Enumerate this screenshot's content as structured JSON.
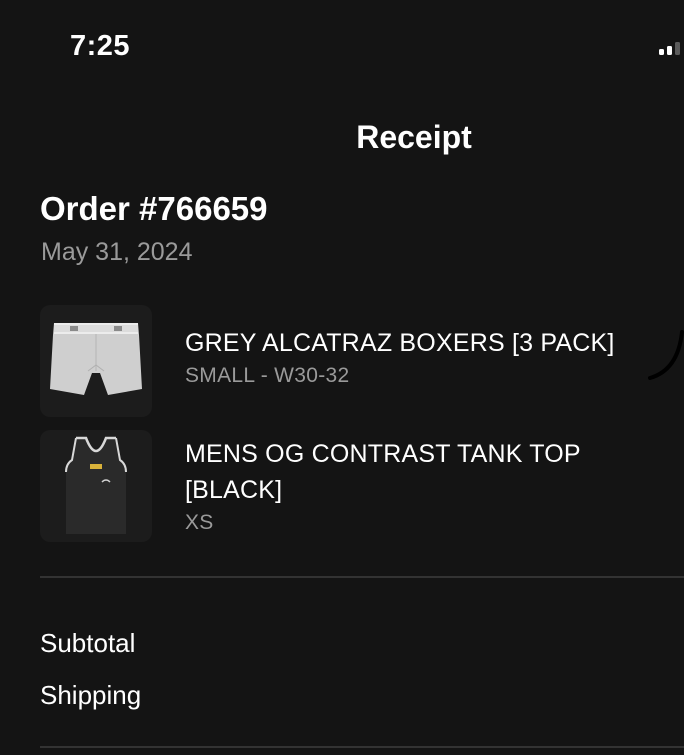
{
  "status_bar": {
    "time": "7:25"
  },
  "header": {
    "title": "Receipt"
  },
  "order": {
    "number_label": "Order #766659",
    "date": "May 31, 2024"
  },
  "items": [
    {
      "name": "GREY ALCATRAZ BOXERS [3 PACK]",
      "variant": "SMALL - W30-32",
      "thumbnail": "grey-boxers-image"
    },
    {
      "name": "MENS OG CONTRAST TANK TOP [BLACK]",
      "variant": "XS",
      "thumbnail": "black-tank-top-image"
    }
  ],
  "summary": {
    "subtotal_label": "Subtotal",
    "shipping_label": "Shipping"
  },
  "colors": {
    "background": "#141414",
    "text_primary": "#ffffff",
    "text_secondary": "#9a9a9a",
    "divider": "#333333"
  }
}
